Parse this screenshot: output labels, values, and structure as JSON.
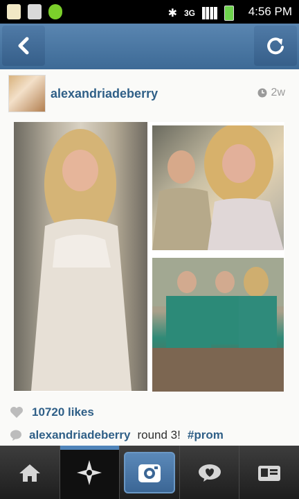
{
  "status_bar": {
    "time": "4:56 PM",
    "network": "3G"
  },
  "nav_bar": {
    "back_icon": "chevron-left-icon",
    "refresh_icon": "refresh-icon"
  },
  "post": {
    "username": "alexandriadeberry",
    "time_ago": "2w",
    "likes_text": "10720 likes",
    "caption": {
      "username": "alexandriadeberry",
      "text": "round 3!",
      "hashtag": "#prom"
    }
  },
  "tab_bar": {
    "tabs": [
      {
        "icon": "home-icon"
      },
      {
        "icon": "explore-icon"
      },
      {
        "icon": "camera-icon"
      },
      {
        "icon": "news-icon"
      },
      {
        "icon": "profile-icon"
      }
    ]
  },
  "colors": {
    "nav_blue": "#4a76a3",
    "link_blue": "#2f5f87",
    "status_bar": "#000000"
  }
}
